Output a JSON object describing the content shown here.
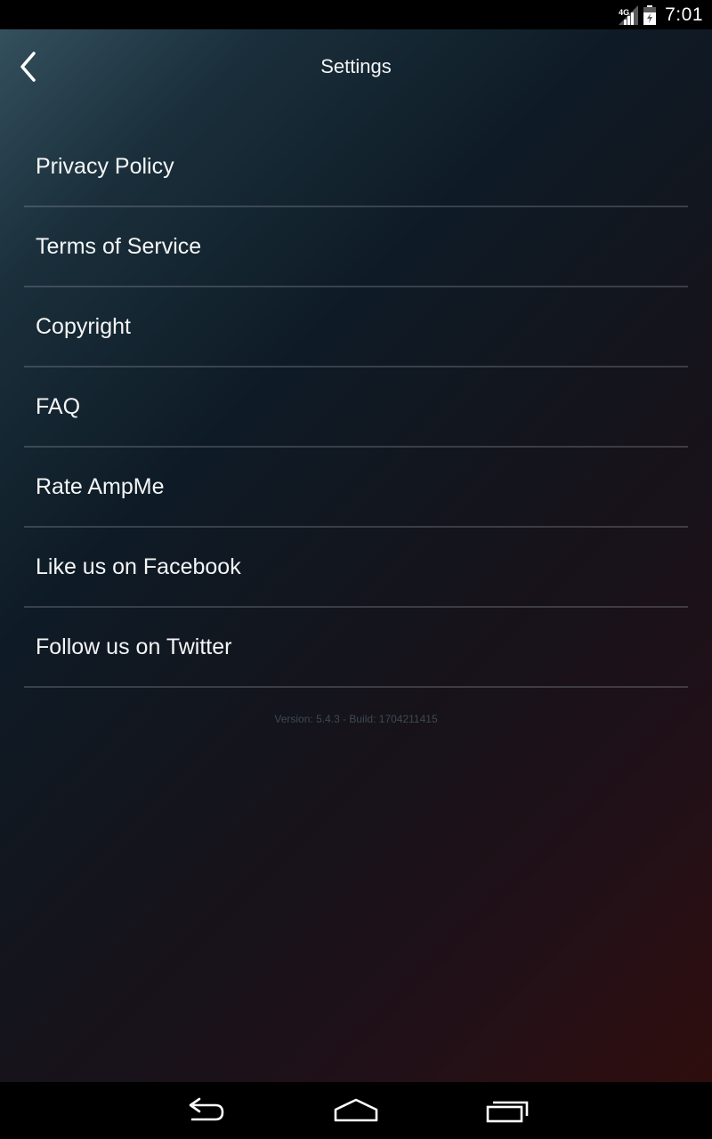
{
  "status_bar": {
    "network_type": "4G",
    "time": "7:01"
  },
  "header": {
    "title": "Settings",
    "back_icon": "chevron-left-icon"
  },
  "menu": {
    "items": [
      {
        "label": "Privacy Policy"
      },
      {
        "label": "Terms of Service"
      },
      {
        "label": "Copyright"
      },
      {
        "label": "FAQ"
      },
      {
        "label": "Rate AmpMe"
      },
      {
        "label": "Like us on Facebook"
      },
      {
        "label": "Follow us on Twitter"
      }
    ]
  },
  "footer": {
    "version": "Version: 5.4.3 - Build: 1704211415"
  },
  "nav_bar": {
    "icons": [
      "back-icon",
      "home-icon",
      "recents-icon"
    ]
  },
  "colors": {
    "text": "#f4f5f6",
    "divider": "#5a6268",
    "version_text": "#3d4a52",
    "background_top": "#34505d",
    "background_bottom": "#2f0d0d"
  }
}
